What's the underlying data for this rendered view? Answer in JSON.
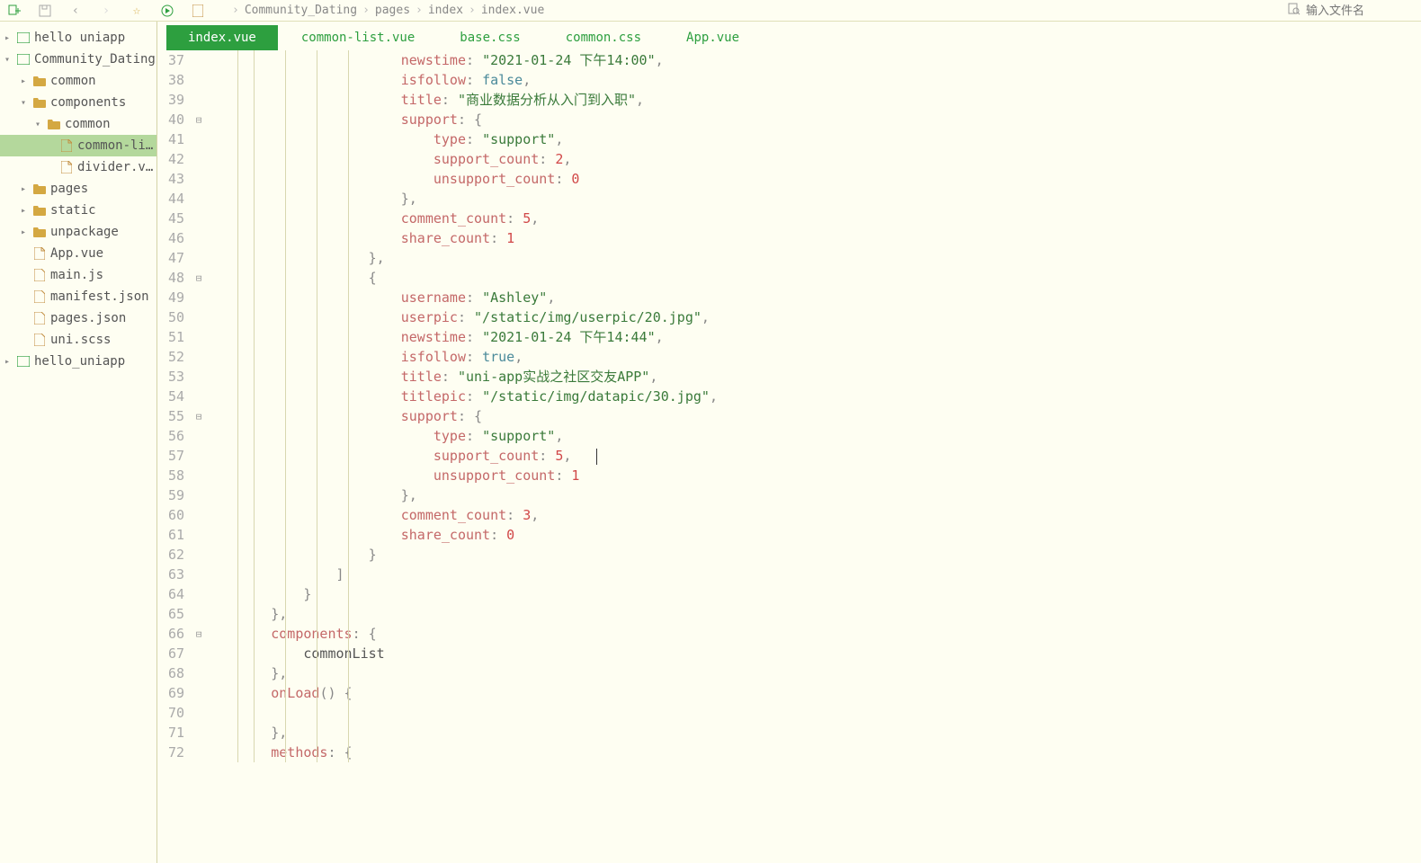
{
  "search": {
    "placeholder": "输入文件名"
  },
  "breadcrumb": [
    "Community_Dating",
    "pages",
    "index",
    "index.vue"
  ],
  "tree": [
    {
      "l": "hello uniapp",
      "d": 0,
      "c": "▸",
      "t": "proj"
    },
    {
      "l": "Community_Dating",
      "d": 0,
      "c": "▾",
      "t": "proj"
    },
    {
      "l": "common",
      "d": 1,
      "c": "▸",
      "t": "folder"
    },
    {
      "l": "components",
      "d": 1,
      "c": "▾",
      "t": "folder"
    },
    {
      "l": "common",
      "d": 2,
      "c": "▾",
      "t": "folder"
    },
    {
      "l": "common-li...",
      "d": 3,
      "c": "",
      "t": "vue",
      "sel": true
    },
    {
      "l": "divider.vue",
      "d": 3,
      "c": "",
      "t": "vue"
    },
    {
      "l": "pages",
      "d": 1,
      "c": "▸",
      "t": "folder"
    },
    {
      "l": "static",
      "d": 1,
      "c": "▸",
      "t": "folder"
    },
    {
      "l": "unpackage",
      "d": 1,
      "c": "▸",
      "t": "folder"
    },
    {
      "l": "App.vue",
      "d": 1,
      "c": "",
      "t": "vue"
    },
    {
      "l": "main.js",
      "d": 1,
      "c": "",
      "t": "js"
    },
    {
      "l": "manifest.json",
      "d": 1,
      "c": "",
      "t": "json"
    },
    {
      "l": "pages.json",
      "d": 1,
      "c": "",
      "t": "json"
    },
    {
      "l": "uni.scss",
      "d": 1,
      "c": "",
      "t": "scss"
    },
    {
      "l": "hello_uniapp",
      "d": 0,
      "c": "▸",
      "t": "proj"
    }
  ],
  "tabs": [
    {
      "l": "index.vue",
      "active": true
    },
    {
      "l": "common-list.vue"
    },
    {
      "l": "base.css"
    },
    {
      "l": "common.css"
    },
    {
      "l": "App.vue"
    }
  ],
  "lines": [
    {
      "n": 37,
      "f": "",
      "p": [
        {
          "t": "                        ",
          "c": ""
        },
        {
          "t": "newstime",
          "c": "prop"
        },
        {
          "t": ": ",
          "c": "punct"
        },
        {
          "t": "\"2021-01-24 下午14:00\"",
          "c": "str"
        },
        {
          "t": ",",
          "c": "punct"
        }
      ]
    },
    {
      "n": 38,
      "f": "",
      "p": [
        {
          "t": "                        ",
          "c": ""
        },
        {
          "t": "isfollow",
          "c": "prop"
        },
        {
          "t": ": ",
          "c": "punct"
        },
        {
          "t": "false",
          "c": "bool"
        },
        {
          "t": ",",
          "c": "punct"
        }
      ]
    },
    {
      "n": 39,
      "f": "",
      "p": [
        {
          "t": "                        ",
          "c": ""
        },
        {
          "t": "title",
          "c": "prop"
        },
        {
          "t": ": ",
          "c": "punct"
        },
        {
          "t": "\"商业数据分析从入门到入职\"",
          "c": "str"
        },
        {
          "t": ",",
          "c": "punct"
        }
      ]
    },
    {
      "n": 40,
      "f": "⊟",
      "p": [
        {
          "t": "                        ",
          "c": ""
        },
        {
          "t": "support",
          "c": "prop"
        },
        {
          "t": ": {",
          "c": "punct"
        }
      ]
    },
    {
      "n": 41,
      "f": "",
      "p": [
        {
          "t": "                            ",
          "c": ""
        },
        {
          "t": "type",
          "c": "prop"
        },
        {
          "t": ": ",
          "c": "punct"
        },
        {
          "t": "\"support\"",
          "c": "str"
        },
        {
          "t": ",",
          "c": "punct"
        }
      ]
    },
    {
      "n": 42,
      "f": "",
      "p": [
        {
          "t": "                            ",
          "c": ""
        },
        {
          "t": "support_count",
          "c": "prop"
        },
        {
          "t": ": ",
          "c": "punct"
        },
        {
          "t": "2",
          "c": "num"
        },
        {
          "t": ",",
          "c": "punct"
        }
      ]
    },
    {
      "n": 43,
      "f": "",
      "p": [
        {
          "t": "                            ",
          "c": ""
        },
        {
          "t": "unsupport_count",
          "c": "prop"
        },
        {
          "t": ": ",
          "c": "punct"
        },
        {
          "t": "0",
          "c": "num"
        }
      ]
    },
    {
      "n": 44,
      "f": "",
      "p": [
        {
          "t": "                        ",
          "c": ""
        },
        {
          "t": "},",
          "c": "punct"
        }
      ]
    },
    {
      "n": 45,
      "f": "",
      "p": [
        {
          "t": "                        ",
          "c": ""
        },
        {
          "t": "comment_count",
          "c": "prop"
        },
        {
          "t": ": ",
          "c": "punct"
        },
        {
          "t": "5",
          "c": "num"
        },
        {
          "t": ",",
          "c": "punct"
        }
      ]
    },
    {
      "n": 46,
      "f": "",
      "p": [
        {
          "t": "                        ",
          "c": ""
        },
        {
          "t": "share_count",
          "c": "prop"
        },
        {
          "t": ": ",
          "c": "punct"
        },
        {
          "t": "1",
          "c": "num"
        }
      ]
    },
    {
      "n": 47,
      "f": "",
      "p": [
        {
          "t": "                    ",
          "c": ""
        },
        {
          "t": "},",
          "c": "punct"
        }
      ]
    },
    {
      "n": 48,
      "f": "⊟",
      "p": [
        {
          "t": "                    ",
          "c": ""
        },
        {
          "t": "{",
          "c": "punct"
        }
      ]
    },
    {
      "n": 49,
      "f": "",
      "p": [
        {
          "t": "                        ",
          "c": ""
        },
        {
          "t": "username",
          "c": "prop"
        },
        {
          "t": ": ",
          "c": "punct"
        },
        {
          "t": "\"Ashley\"",
          "c": "str"
        },
        {
          "t": ",",
          "c": "punct"
        }
      ]
    },
    {
      "n": 50,
      "f": "",
      "p": [
        {
          "t": "                        ",
          "c": ""
        },
        {
          "t": "userpic",
          "c": "prop"
        },
        {
          "t": ": ",
          "c": "punct"
        },
        {
          "t": "\"/static/img/userpic/20.jpg\"",
          "c": "str"
        },
        {
          "t": ",",
          "c": "punct"
        }
      ]
    },
    {
      "n": 51,
      "f": "",
      "p": [
        {
          "t": "                        ",
          "c": ""
        },
        {
          "t": "newstime",
          "c": "prop"
        },
        {
          "t": ": ",
          "c": "punct"
        },
        {
          "t": "\"2021-01-24 下午14:44\"",
          "c": "str"
        },
        {
          "t": ",",
          "c": "punct"
        }
      ]
    },
    {
      "n": 52,
      "f": "",
      "p": [
        {
          "t": "                        ",
          "c": ""
        },
        {
          "t": "isfollow",
          "c": "prop"
        },
        {
          "t": ": ",
          "c": "punct"
        },
        {
          "t": "true",
          "c": "bool"
        },
        {
          "t": ",",
          "c": "punct"
        }
      ]
    },
    {
      "n": 53,
      "f": "",
      "p": [
        {
          "t": "                        ",
          "c": ""
        },
        {
          "t": "title",
          "c": "prop"
        },
        {
          "t": ": ",
          "c": "punct"
        },
        {
          "t": "\"uni-app实战之社区交友APP\"",
          "c": "str"
        },
        {
          "t": ",",
          "c": "punct"
        }
      ]
    },
    {
      "n": 54,
      "f": "",
      "p": [
        {
          "t": "                        ",
          "c": ""
        },
        {
          "t": "titlepic",
          "c": "prop"
        },
        {
          "t": ": ",
          "c": "punct"
        },
        {
          "t": "\"/static/img/datapic/30.jpg\"",
          "c": "str"
        },
        {
          "t": ",",
          "c": "punct"
        }
      ]
    },
    {
      "n": 55,
      "f": "⊟",
      "p": [
        {
          "t": "                        ",
          "c": ""
        },
        {
          "t": "support",
          "c": "prop"
        },
        {
          "t": ": {",
          "c": "punct"
        }
      ]
    },
    {
      "n": 56,
      "f": "",
      "p": [
        {
          "t": "                            ",
          "c": ""
        },
        {
          "t": "type",
          "c": "prop"
        },
        {
          "t": ": ",
          "c": "punct"
        },
        {
          "t": "\"support\"",
          "c": "str"
        },
        {
          "t": ",",
          "c": "punct"
        }
      ]
    },
    {
      "n": 57,
      "f": "",
      "p": [
        {
          "t": "                            ",
          "c": ""
        },
        {
          "t": "support_count",
          "c": "prop"
        },
        {
          "t": ": ",
          "c": "punct"
        },
        {
          "t": "5",
          "c": "num"
        },
        {
          "t": ",",
          "c": "punct"
        }
      ],
      "cur": true
    },
    {
      "n": 58,
      "f": "",
      "p": [
        {
          "t": "                            ",
          "c": ""
        },
        {
          "t": "unsupport_count",
          "c": "prop"
        },
        {
          "t": ": ",
          "c": "punct"
        },
        {
          "t": "1",
          "c": "num"
        }
      ]
    },
    {
      "n": 59,
      "f": "",
      "p": [
        {
          "t": "                        ",
          "c": ""
        },
        {
          "t": "},",
          "c": "punct"
        }
      ]
    },
    {
      "n": 60,
      "f": "",
      "p": [
        {
          "t": "                        ",
          "c": ""
        },
        {
          "t": "comment_count",
          "c": "prop"
        },
        {
          "t": ": ",
          "c": "punct"
        },
        {
          "t": "3",
          "c": "num"
        },
        {
          "t": ",",
          "c": "punct"
        }
      ]
    },
    {
      "n": 61,
      "f": "",
      "p": [
        {
          "t": "                        ",
          "c": ""
        },
        {
          "t": "share_count",
          "c": "prop"
        },
        {
          "t": ": ",
          "c": "punct"
        },
        {
          "t": "0",
          "c": "num"
        }
      ]
    },
    {
      "n": 62,
      "f": "",
      "p": [
        {
          "t": "                    ",
          "c": ""
        },
        {
          "t": "}",
          "c": "punct"
        }
      ]
    },
    {
      "n": 63,
      "f": "",
      "p": [
        {
          "t": "                ",
          "c": ""
        },
        {
          "t": "]",
          "c": "punct"
        }
      ]
    },
    {
      "n": 64,
      "f": "",
      "p": [
        {
          "t": "            ",
          "c": ""
        },
        {
          "t": "}",
          "c": "punct"
        }
      ]
    },
    {
      "n": 65,
      "f": "",
      "p": [
        {
          "t": "        ",
          "c": ""
        },
        {
          "t": "},",
          "c": "punct"
        }
      ]
    },
    {
      "n": 66,
      "f": "⊟",
      "p": [
        {
          "t": "        ",
          "c": ""
        },
        {
          "t": "components",
          "c": "prop"
        },
        {
          "t": ": {",
          "c": "punct"
        }
      ]
    },
    {
      "n": 67,
      "f": "",
      "p": [
        {
          "t": "            ",
          "c": ""
        },
        {
          "t": "commonList",
          "c": "ident"
        }
      ]
    },
    {
      "n": 68,
      "f": "",
      "p": [
        {
          "t": "        ",
          "c": ""
        },
        {
          "t": "},",
          "c": "punct"
        }
      ]
    },
    {
      "n": 69,
      "f": "",
      "p": [
        {
          "t": "        ",
          "c": ""
        },
        {
          "t": "onLoad",
          "c": "prop"
        },
        {
          "t": "() {",
          "c": "punct"
        }
      ]
    },
    {
      "n": 70,
      "f": "",
      "p": [
        {
          "t": "            ",
          "c": ""
        }
      ]
    },
    {
      "n": 71,
      "f": "",
      "p": [
        {
          "t": "        ",
          "c": ""
        },
        {
          "t": "},",
          "c": "punct"
        }
      ]
    },
    {
      "n": 72,
      "f": "",
      "p": [
        {
          "t": "        ",
          "c": ""
        },
        {
          "t": "methods",
          "c": "prop"
        },
        {
          "t": ": {",
          "c": "punct"
        }
      ]
    }
  ]
}
